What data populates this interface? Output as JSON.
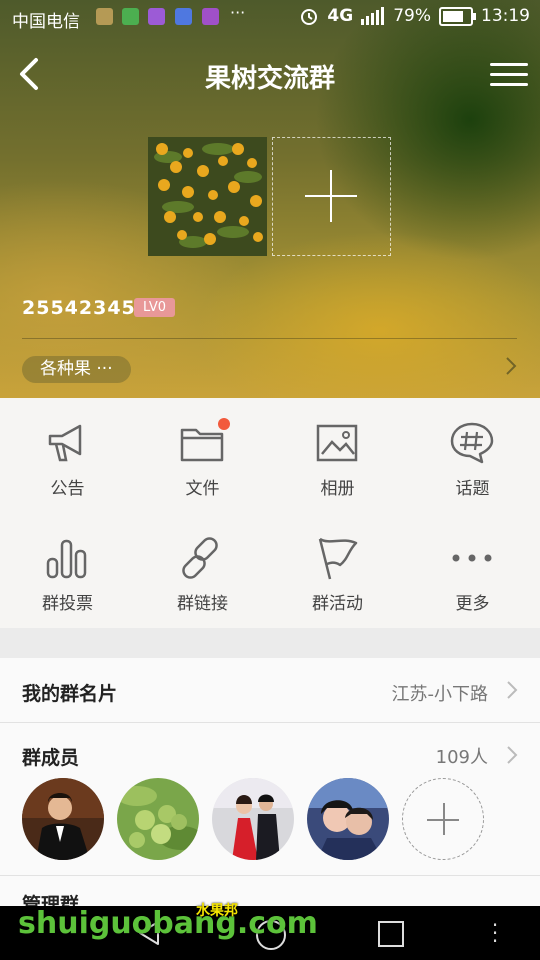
{
  "status_bar": {
    "carrier": "中国电信",
    "dots": "···",
    "network": "4G",
    "battery": "79%",
    "time": "13:19"
  },
  "header": {
    "title": "果树交流群"
  },
  "group": {
    "number": "255423450",
    "level": "LV0",
    "tag": "各种果 ···"
  },
  "features": [
    {
      "label": "公告",
      "icon": "megaphone-icon"
    },
    {
      "label": "文件",
      "icon": "folder-icon",
      "badge": true
    },
    {
      "label": "相册",
      "icon": "album-icon"
    },
    {
      "label": "话题",
      "icon": "hashtag-icon"
    },
    {
      "label": "群投票",
      "icon": "poll-icon"
    },
    {
      "label": "群链接",
      "icon": "link-icon"
    },
    {
      "label": "群活动",
      "icon": "flag-icon"
    },
    {
      "label": "更多",
      "icon": "more-icon"
    }
  ],
  "card": {
    "label": "我的群名片",
    "value": "江苏-小下路"
  },
  "members": {
    "label": "群成员",
    "count": "109人"
  },
  "manage": {
    "label": "管理群"
  },
  "watermark": {
    "main": "shuiguobang.com",
    "sub": "水果邦"
  },
  "colors": {
    "badge": "#f25a3c",
    "level_badge": "#e89898",
    "watermark": "#5cc23a"
  }
}
